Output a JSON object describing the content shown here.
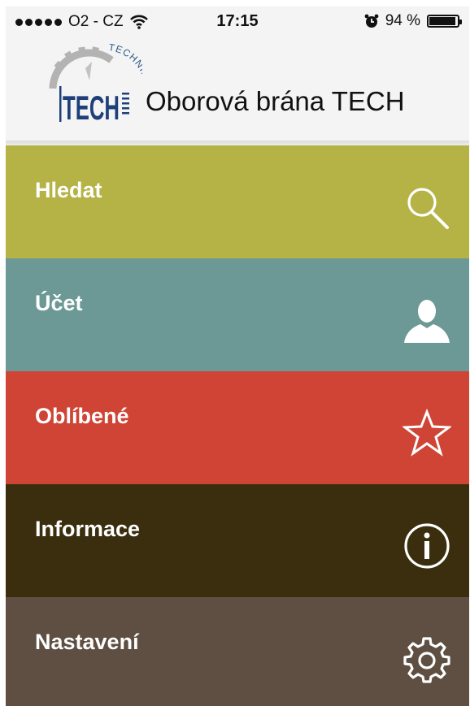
{
  "status_bar": {
    "carrier": "O2 - CZ",
    "time": "17:15",
    "battery_text": "94 %",
    "battery_level": 0.94,
    "signal_icon": "signal-dots-icon",
    "wifi_icon": "wifi-icon",
    "alarm_icon": "alarm-clock-icon"
  },
  "header": {
    "logo": {
      "main": "TECH",
      "arc": "TECHNIKA",
      "icon": "gear-logo"
    },
    "title": "Oborová brána TECH"
  },
  "menu": [
    {
      "label": "Hledat",
      "color": "#b5b246",
      "icon": "search-icon"
    },
    {
      "label": "Účet",
      "color": "#6c9996",
      "icon": "user-icon"
    },
    {
      "label": "Oblíbené",
      "color": "#cf4435",
      "icon": "star-icon"
    },
    {
      "label": "Informace",
      "color": "#3a2e0e",
      "icon": "info-icon"
    },
    {
      "label": "Nastavení",
      "color": "#5e4f42",
      "icon": "gear-icon"
    }
  ]
}
